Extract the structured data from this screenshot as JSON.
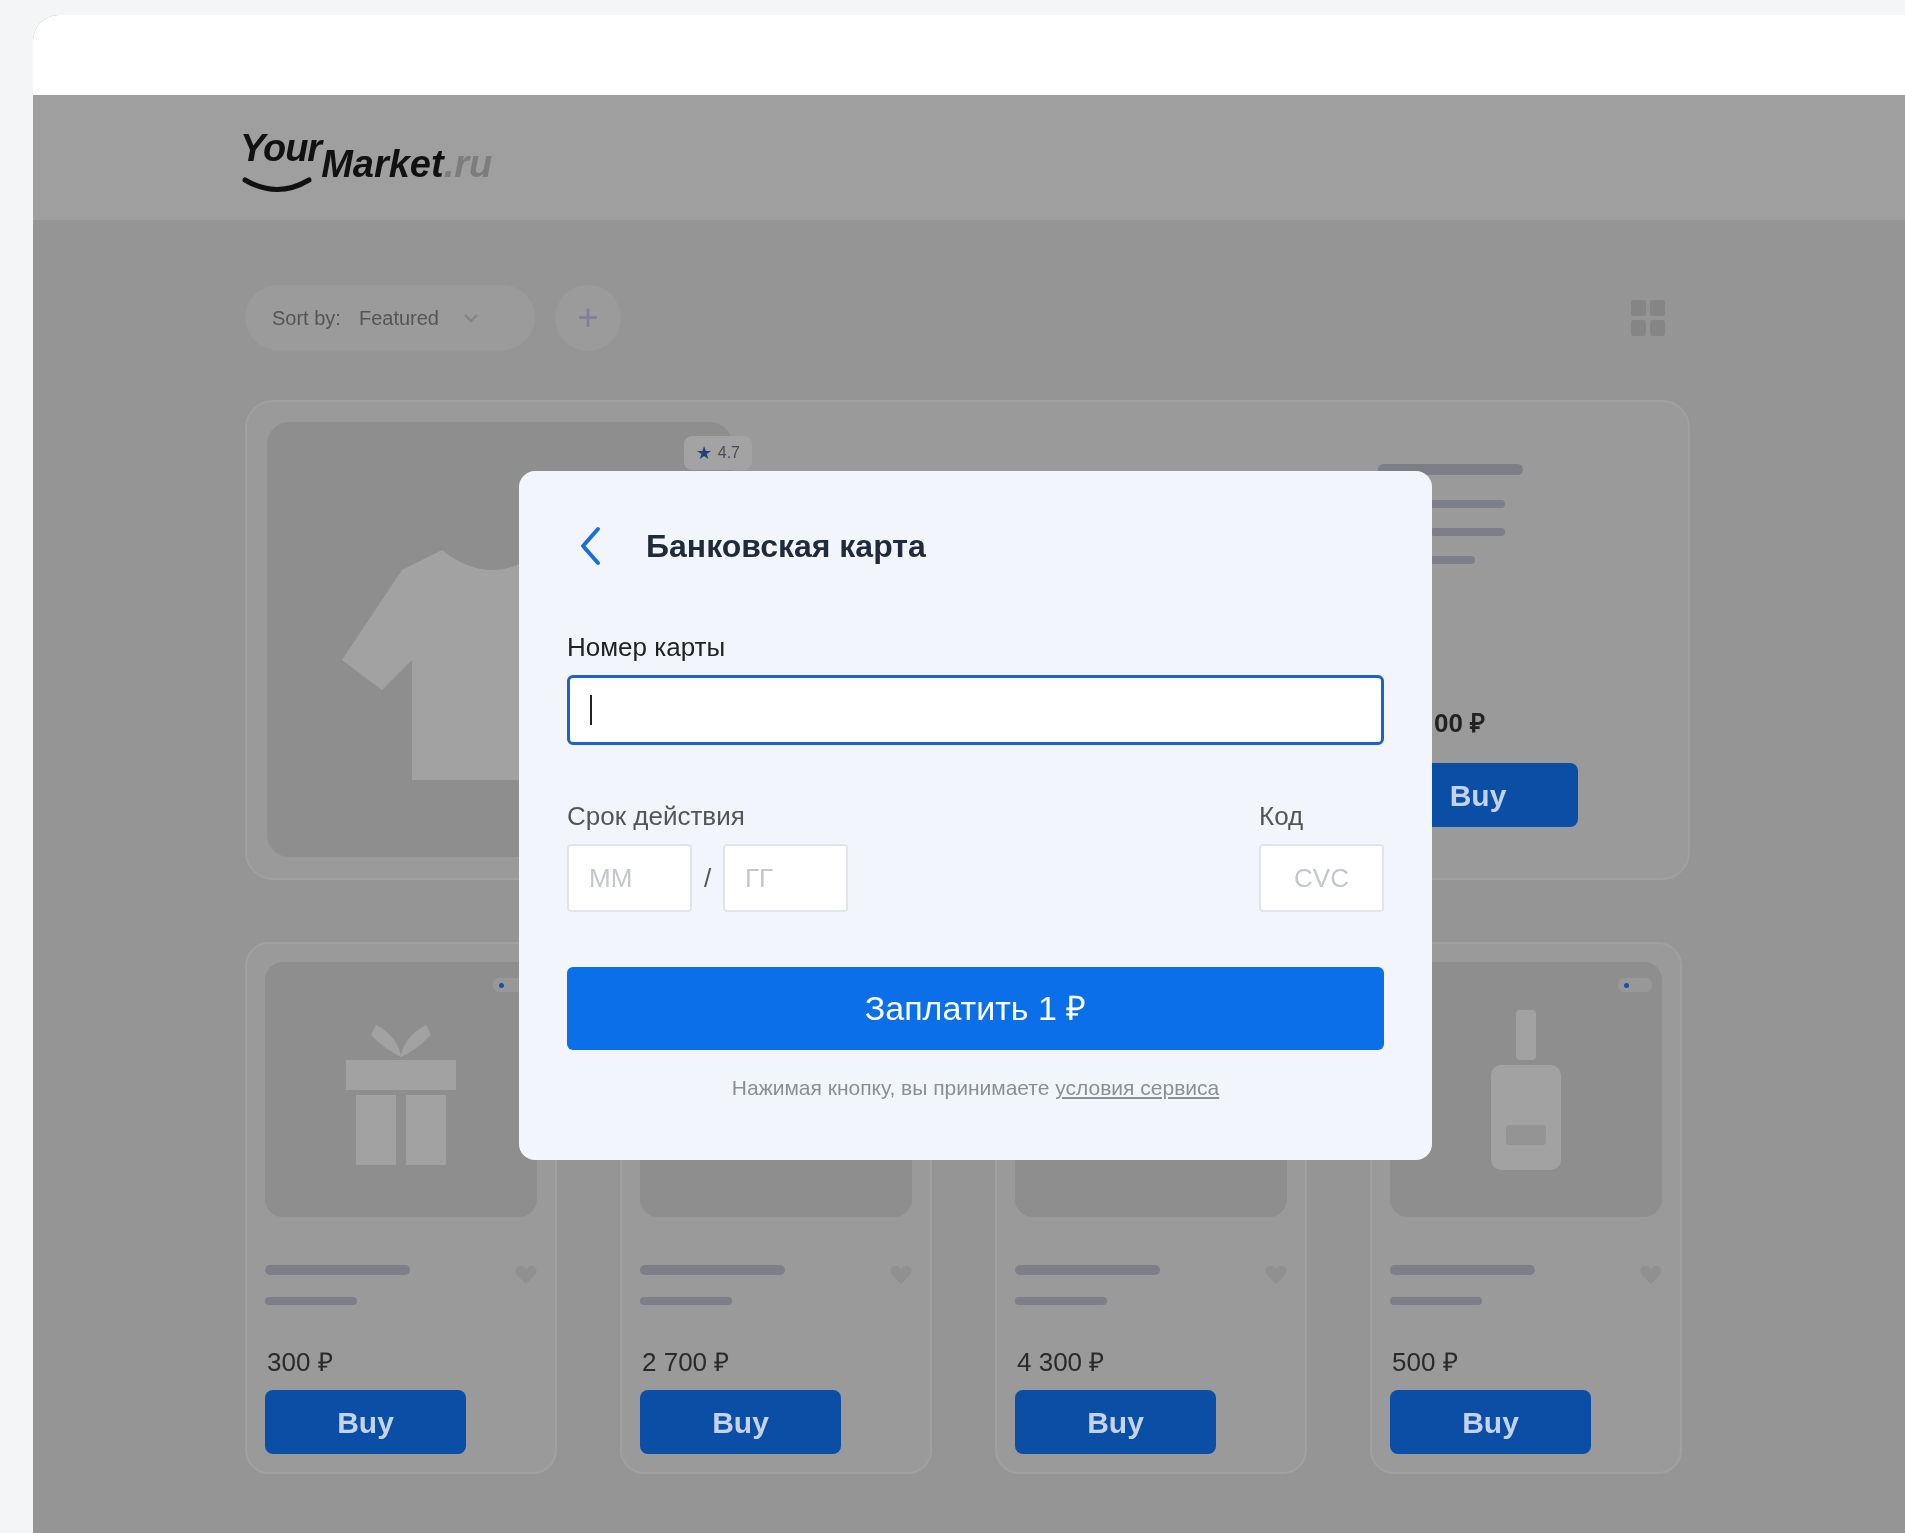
{
  "logo": {
    "your": "Your",
    "market": "Market",
    "tld": ".ru"
  },
  "toolbar": {
    "sort_label": "Sort by:",
    "sort_value": "Featured",
    "add_button": "+"
  },
  "featured_card": {
    "star": "★",
    "rating": "4.7",
    "price": "00 ₽",
    "button": "Buy"
  },
  "cards": [
    {
      "kind": "gift",
      "price": "300 ₽",
      "button": "Buy"
    },
    {
      "kind": "blank",
      "price": "2 700 ₽",
      "button": "Buy"
    },
    {
      "kind": "blank",
      "price": "4 300 ₽",
      "button": "Buy"
    },
    {
      "kind": "bottle",
      "price": "500 ₽",
      "button": "Buy"
    }
  ],
  "modal": {
    "title": "Банковская карта",
    "card_number": {
      "label": "Номер карты",
      "focused": true
    },
    "expiry": {
      "label": "Срок действия",
      "month_placeholder": "ММ",
      "separator": "/",
      "year_placeholder": "ГГ"
    },
    "code": {
      "label": "Код",
      "placeholder": "CVC"
    },
    "pay_button": "Заплатить 1 ₽",
    "terms": {
      "text": "Нажимая кнопку, вы принимаете ",
      "link": "условия сервиса"
    }
  }
}
